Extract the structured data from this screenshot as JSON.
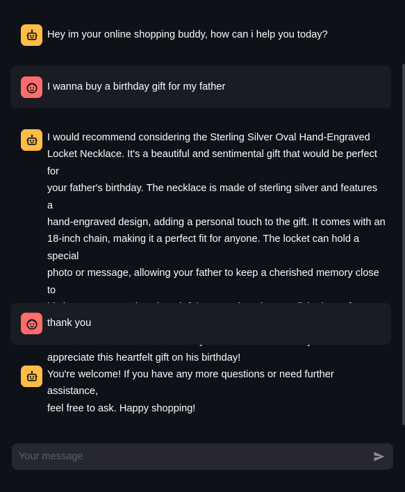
{
  "messages": [
    {
      "role": "assistant",
      "icon": "robot-icon",
      "text": "Hey im your online shopping buddy, how can i help you today?"
    },
    {
      "role": "user",
      "icon": "user-face-icon",
      "text": "I wanna buy a birthday gift for my father"
    },
    {
      "role": "assistant",
      "icon": "robot-icon",
      "text": "I would recommend considering the Sterling Silver Oval Hand-Engraved\nLocket Necklace. It's a beautiful and sentimental gift that would be perfect for\nyour father's birthday. The necklace is made of sterling silver and features a\nhand-engraved design, adding a personal touch to the gift. It comes with an\n18-inch chain, making it a perfect fit for anyone. The locket can hold a special\nphoto or message, allowing your father to keep a cherished memory close to\nhis heart. It's not only a thoughtful present but also a stylish piece of jewelry\nthat he can wear and treasure for years to come. I'm sure your father will\nappreciate this heartfelt gift on his birthday!"
    },
    {
      "role": "user",
      "icon": "user-face-icon",
      "text": "thank you"
    },
    {
      "role": "assistant",
      "icon": "robot-icon",
      "text": "You're welcome! If you have any more questions or need further assistance,\nfeel free to ask. Happy shopping!"
    }
  ],
  "chat_input": {
    "placeholder": "Your message",
    "value": "",
    "send_icon": "send-icon"
  },
  "colors": {
    "background": "#0e1117",
    "user_message_bg": "#1a1c24",
    "assistant_avatar": "#ffbd45",
    "user_avatar": "#ff6c6c",
    "input_bg": "#262730"
  }
}
